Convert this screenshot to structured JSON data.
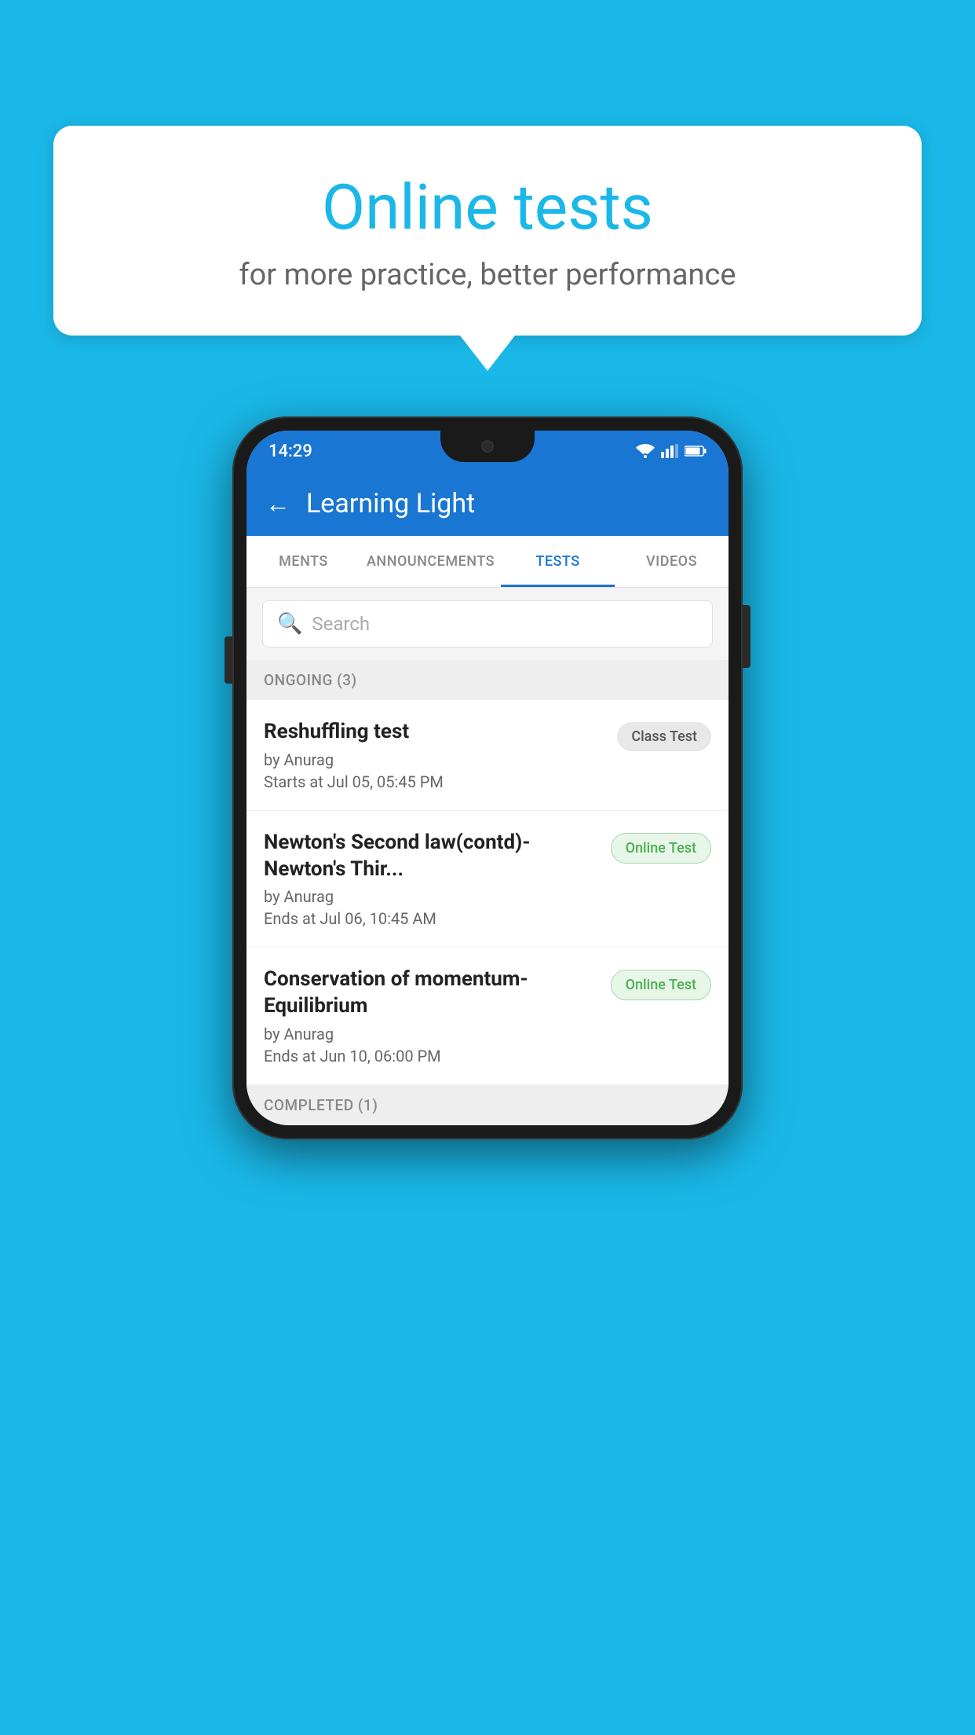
{
  "background_color": "#1ab8e8",
  "bubble": {
    "title": "Online tests",
    "subtitle": "for more practice, better performance"
  },
  "phone": {
    "status_bar": {
      "time": "14:29"
    },
    "app_bar": {
      "back_icon": "←",
      "title": "Learning Light"
    },
    "tabs": [
      {
        "label": "MENTS",
        "active": false
      },
      {
        "label": "ANNOUNCEMENTS",
        "active": false
      },
      {
        "label": "TESTS",
        "active": true
      },
      {
        "label": "VIDEOS",
        "active": false
      }
    ],
    "search": {
      "placeholder": "Search"
    },
    "ongoing_section": {
      "header": "ONGOING (3)",
      "tests": [
        {
          "title": "Reshuffling test",
          "author": "by Anurag",
          "date": "Starts at  Jul 05, 05:45 PM",
          "badge": "Class Test",
          "badge_type": "class"
        },
        {
          "title": "Newton's Second law(contd)-Newton's Thir...",
          "author": "by Anurag",
          "date": "Ends at  Jul 06, 10:45 AM",
          "badge": "Online Test",
          "badge_type": "online"
        },
        {
          "title": "Conservation of momentum-Equilibrium",
          "author": "by Anurag",
          "date": "Ends at  Jun 10, 06:00 PM",
          "badge": "Online Test",
          "badge_type": "online"
        }
      ]
    },
    "completed_section": {
      "header": "COMPLETED (1)"
    }
  }
}
